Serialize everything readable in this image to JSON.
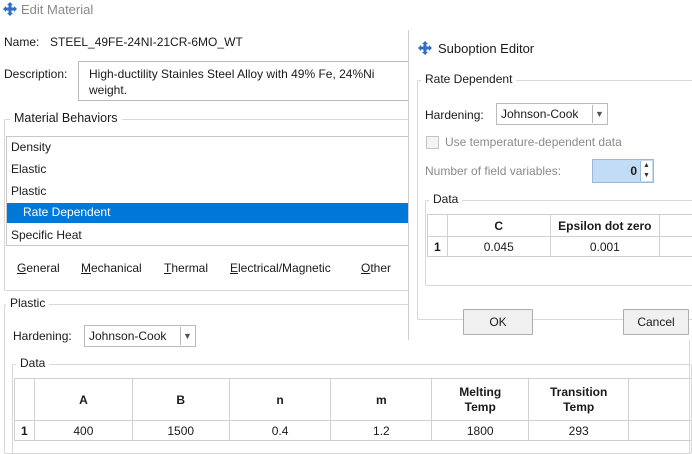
{
  "window": {
    "title": "Edit Material"
  },
  "name": {
    "label": "Name:",
    "value": "STEEL_49FE-24NI-21CR-6MO_WT"
  },
  "description": {
    "label": "Description:",
    "line1": "High-ductility Stainles Steel Alloy with 49% Fe, 24%Ni",
    "line2": "weight."
  },
  "behaviors": {
    "title": "Material Behaviors",
    "items": [
      "Density",
      "Elastic",
      "Plastic",
      "Rate Dependent",
      "Specific Heat"
    ],
    "selected_index": 3
  },
  "menu": {
    "items": [
      {
        "first": "G",
        "rest": "eneral"
      },
      {
        "first": "M",
        "rest": "echanical"
      },
      {
        "first": "T",
        "rest": "hermal"
      },
      {
        "first": "E",
        "rest": "lectrical/Magnetic"
      },
      {
        "first": "O",
        "rest": "ther"
      }
    ]
  },
  "plastic": {
    "title": "Plastic",
    "hardening_label": "Hardening:",
    "hardening_value": "Johnson-Cook",
    "data_title": "Data",
    "headers": [
      "A",
      "B",
      "n",
      "m",
      "Melting Temp",
      "Transition Temp"
    ],
    "rows": [
      {
        "index": "1",
        "values": [
          "400",
          "1500",
          "0.4",
          "1.2",
          "1800",
          "293"
        ]
      }
    ]
  },
  "suboption": {
    "title": "Suboption Editor",
    "group_title": "Rate Dependent",
    "hardening_label": "Hardening:",
    "hardening_value": "Johnson-Cook",
    "temp_dependent_label": "Use temperature-dependent data",
    "field_vars_label": "Number of field variables:",
    "field_vars_value": "0",
    "data_title": "Data",
    "headers": [
      "C",
      "Epsilon dot zero"
    ],
    "rows": [
      {
        "index": "1",
        "values": [
          "0.045",
          "0.001"
        ]
      }
    ],
    "ok_label": "OK",
    "cancel_label": "Cancel"
  },
  "colors": {
    "selection": "#0078d7",
    "icon_blue": "#2f6fc4",
    "spin_highlight": "#c3dcf5"
  }
}
